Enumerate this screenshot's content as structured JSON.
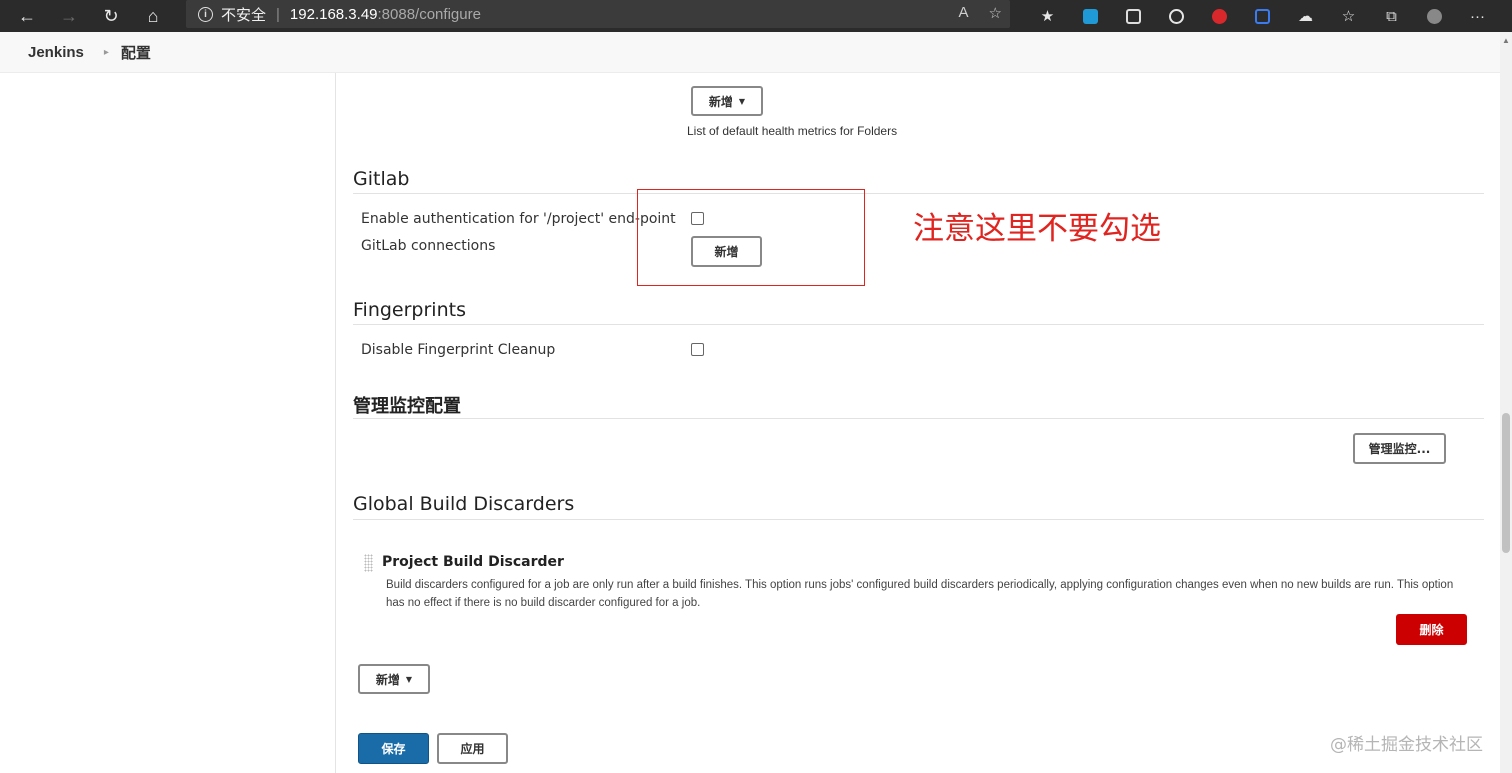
{
  "browser": {
    "back_icon": "←",
    "forward_icon": "→",
    "reload_icon": "↻",
    "home_icon": "⌂",
    "security_label": "不安全",
    "url_host": "192.168.3.49",
    "url_rest": ":8088/configure",
    "read_aloud_icon": "A",
    "favorite_icon": "☆",
    "more_icon": "···"
  },
  "breadcrumb": {
    "root": "Jenkins",
    "current": "配置"
  },
  "folders": {
    "add_label": "新增",
    "help": "List of default health metrics for Folders"
  },
  "gitlab": {
    "title": "Gitlab",
    "auth_label": "Enable authentication for '/project' end-point",
    "connections_label": "GitLab connections",
    "add_label": "新增"
  },
  "annotation": {
    "text": "注意这里不要勾选",
    "color": "#e0241f"
  },
  "fingerprints": {
    "title": "Fingerprints",
    "disable_label": "Disable Fingerprint Cleanup"
  },
  "monitoring": {
    "title": "管理监控配置",
    "button_label": "管理监控..."
  },
  "discarders": {
    "title": "Global Build Discarders",
    "item_title": "Project Build Discarder",
    "item_desc": "Build discarders configured for a job are only run after a build finishes. This option runs jobs' configured build discarders periodically, applying configuration changes even when no new builds are run. This option has no effect if there is no build discarder configured for a job.",
    "delete_label": "删除",
    "add_label": "新增"
  },
  "footer": {
    "save_label": "保存",
    "apply_label": "应用"
  },
  "watermark": "@稀土掘金技术社区",
  "colors": {
    "save": "#1a6ca8",
    "delete": "#cc0000"
  }
}
